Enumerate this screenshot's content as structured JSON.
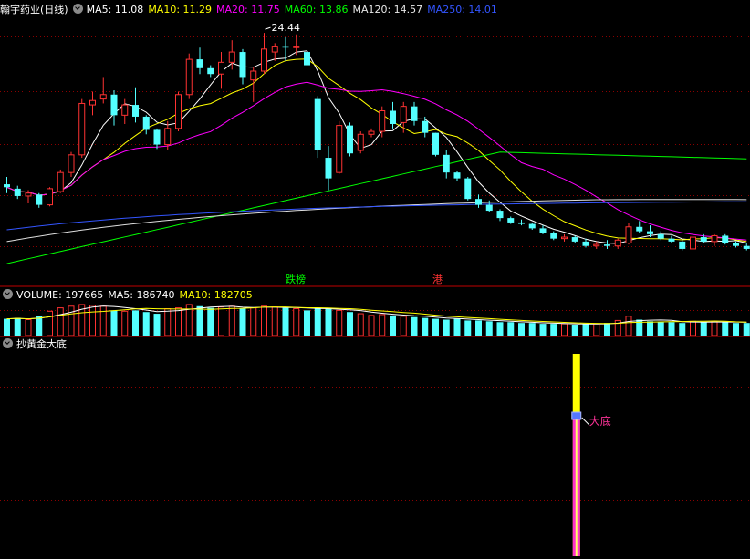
{
  "price_header": {
    "title": "翰宇药业(日线)",
    "ma": [
      {
        "label": "MA5: 11.08",
        "color": "#ffffff"
      },
      {
        "label": "MA10: 11.29",
        "color": "#ffff00"
      },
      {
        "label": "MA20: 11.75",
        "color": "#ff00ff"
      },
      {
        "label": "MA60: 13.86",
        "color": "#00ff00"
      },
      {
        "label": "MA120: 14.57",
        "color": "#e8e8e8"
      },
      {
        "label": "MA250: 14.01",
        "color": "#3355ff"
      }
    ]
  },
  "volume_header": {
    "items": [
      {
        "label": "VOLUME: 197665",
        "color": "#ffffff"
      },
      {
        "label": "MA5: 186740",
        "color": "#ffffff"
      },
      {
        "label": "MA10: 182705",
        "color": "#ffff00"
      }
    ]
  },
  "indicator_header": {
    "title": "抄黄金大底"
  },
  "annotations": {
    "peak": "24.44",
    "tag1": "跌榜",
    "tag2": "港",
    "signal": "大底"
  },
  "colors": {
    "up": "#ff3232",
    "down": "#54ffff",
    "grid": "#8b0000",
    "border": "#c00000"
  },
  "chart_data": {
    "type": "candlestick",
    "price_range": [
      8.5,
      26.5
    ],
    "candles": [
      [
        15.2,
        15.7,
        14.6,
        15.0
      ],
      [
        14.9,
        15.1,
        14.2,
        14.4
      ],
      [
        14.4,
        14.8,
        13.9,
        14.6
      ],
      [
        14.5,
        14.6,
        13.6,
        13.8
      ],
      [
        13.8,
        15.0,
        13.7,
        14.9
      ],
      [
        14.7,
        16.2,
        14.6,
        16.0
      ],
      [
        16.0,
        17.4,
        15.7,
        17.2
      ],
      [
        17.2,
        21.0,
        17.0,
        20.7
      ],
      [
        20.6,
        21.5,
        19.9,
        20.9
      ],
      [
        21.0,
        22.5,
        20.7,
        21.3
      ],
      [
        21.3,
        21.6,
        19.2,
        19.9
      ],
      [
        19.9,
        21.0,
        19.3,
        20.6
      ],
      [
        20.6,
        21.8,
        19.4,
        19.8
      ],
      [
        19.8,
        19.9,
        18.6,
        18.9
      ],
      [
        18.9,
        19.0,
        17.6,
        17.9
      ],
      [
        17.9,
        19.5,
        17.5,
        19.0
      ],
      [
        19.0,
        21.5,
        18.8,
        21.3
      ],
      [
        21.3,
        24.1,
        21.0,
        23.7
      ],
      [
        23.7,
        24.5,
        22.7,
        23.1
      ],
      [
        23.1,
        23.3,
        22.5,
        22.7
      ],
      [
        22.7,
        24.2,
        21.7,
        23.5
      ],
      [
        23.5,
        25.0,
        23.0,
        24.2
      ],
      [
        24.2,
        24.4,
        22.0,
        22.5
      ],
      [
        22.3,
        23.2,
        20.8,
        22.9
      ],
      [
        22.9,
        25.5,
        22.7,
        24.4
      ],
      [
        24.2,
        24.8,
        23.6,
        24.6
      ],
      [
        24.6,
        25.2,
        23.6,
        24.5
      ],
      [
        24.5,
        25.4,
        24.0,
        24.6
      ],
      [
        24.2,
        24.6,
        23.0,
        23.3
      ],
      [
        21.0,
        21.2,
        17.0,
        17.5
      ],
      [
        17.0,
        17.8,
        14.8,
        15.6
      ],
      [
        16.0,
        19.5,
        15.9,
        19.2
      ],
      [
        19.2,
        19.4,
        17.1,
        17.3
      ],
      [
        17.5,
        18.8,
        17.3,
        18.6
      ],
      [
        18.6,
        19.0,
        18.4,
        18.8
      ],
      [
        18.8,
        20.5,
        18.4,
        20.2
      ],
      [
        20.2,
        20.8,
        19.0,
        19.3
      ],
      [
        19.4,
        20.8,
        18.7,
        20.5
      ],
      [
        20.5,
        20.8,
        19.2,
        19.5
      ],
      [
        19.5,
        19.8,
        18.4,
        18.7
      ],
      [
        18.7,
        18.7,
        17.1,
        17.2
      ],
      [
        17.2,
        17.5,
        15.6,
        16.0
      ],
      [
        16.0,
        16.1,
        15.4,
        15.6
      ],
      [
        15.6,
        15.7,
        14.1,
        14.2
      ],
      [
        14.2,
        14.5,
        13.6,
        13.8
      ],
      [
        13.8,
        14.1,
        13.3,
        13.4
      ],
      [
        13.4,
        13.5,
        12.7,
        12.9
      ],
      [
        12.9,
        13.0,
        12.5,
        12.6
      ],
      [
        12.6,
        12.8,
        12.4,
        12.5
      ],
      [
        12.5,
        12.6,
        12.1,
        12.2
      ],
      [
        12.2,
        12.4,
        11.8,
        11.9
      ],
      [
        11.9,
        12.0,
        11.4,
        11.5
      ],
      [
        11.5,
        11.8,
        11.3,
        11.6
      ],
      [
        11.6,
        11.7,
        11.2,
        11.3
      ],
      [
        11.3,
        11.5,
        10.9,
        11.0
      ],
      [
        11.0,
        11.3,
        10.8,
        11.1
      ],
      [
        11.1,
        11.4,
        10.8,
        11.0
      ],
      [
        11.0,
        11.5,
        10.8,
        11.4
      ],
      [
        11.2,
        12.6,
        11.1,
        12.3
      ],
      [
        12.3,
        12.7,
        11.9,
        12.0
      ],
      [
        12.0,
        12.4,
        11.6,
        11.8
      ],
      [
        11.8,
        12.0,
        11.4,
        11.5
      ],
      [
        11.5,
        11.7,
        11.2,
        11.3
      ],
      [
        11.3,
        11.4,
        10.7,
        10.8
      ],
      [
        10.8,
        11.8,
        10.7,
        11.6
      ],
      [
        11.6,
        11.8,
        11.2,
        11.3
      ],
      [
        11.3,
        11.8,
        11.0,
        11.7
      ],
      [
        11.7,
        11.8,
        11.1,
        11.2
      ],
      [
        11.2,
        11.3,
        10.9,
        11.0
      ],
      [
        11.0,
        11.2,
        10.7,
        10.8
      ]
    ],
    "volume_range": [
      0,
      380000
    ],
    "volumes": [
      200000,
      210000,
      190000,
      230000,
      290000,
      330000,
      350000,
      370000,
      360000,
      350000,
      300000,
      290000,
      300000,
      280000,
      260000,
      320000,
      330000,
      370000,
      350000,
      330000,
      340000,
      350000,
      320000,
      330000,
      350000,
      340000,
      330000,
      320000,
      300000,
      330000,
      320000,
      300000,
      280000,
      260000,
      240000,
      250000,
      240000,
      230000,
      220000,
      210000,
      200000,
      190000,
      200000,
      180000,
      180000,
      170000,
      160000,
      160000,
      150000,
      150000,
      140000,
      140000,
      140000,
      130000,
      140000,
      140000,
      150000,
      180000,
      230000,
      190000,
      170000,
      160000,
      160000,
      150000,
      170000,
      160000,
      170000,
      160000,
      150000,
      150000
    ],
    "signal": {
      "label": "大底",
      "bar_index": 53
    }
  }
}
